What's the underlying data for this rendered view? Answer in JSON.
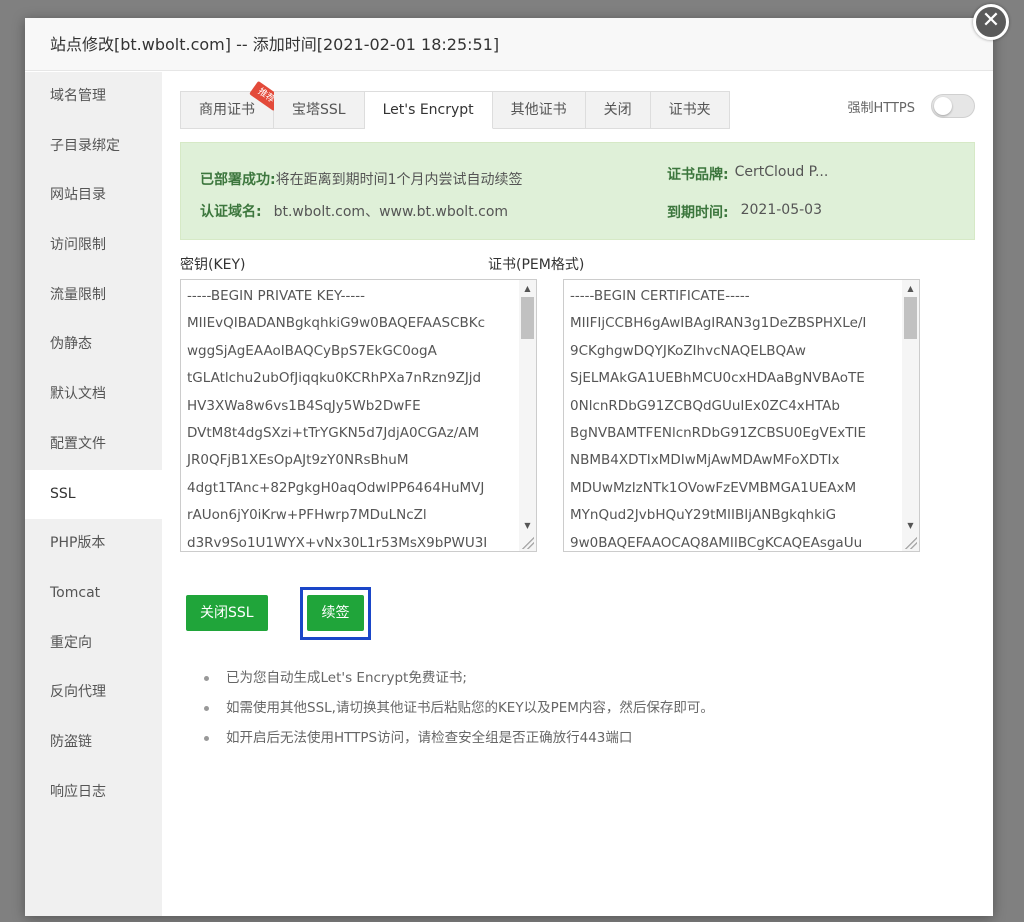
{
  "dialog": {
    "title": "站点修改[bt.wbolt.com] -- 添加时间[2021-02-01 18:25:51]",
    "close_icon": "close-icon"
  },
  "sidebar": {
    "items": [
      {
        "label": "域名管理"
      },
      {
        "label": "子目录绑定"
      },
      {
        "label": "网站目录"
      },
      {
        "label": "访问限制"
      },
      {
        "label": "流量限制"
      },
      {
        "label": "伪静态"
      },
      {
        "label": "默认文档"
      },
      {
        "label": "配置文件"
      },
      {
        "label": "SSL",
        "active": true
      },
      {
        "label": "PHP版本"
      },
      {
        "label": "Tomcat"
      },
      {
        "label": "重定向"
      },
      {
        "label": "反向代理"
      },
      {
        "label": "防盗链"
      },
      {
        "label": "响应日志"
      }
    ]
  },
  "tabs": [
    {
      "label": "商用证书",
      "badge": "推荐"
    },
    {
      "label": "宝塔SSL"
    },
    {
      "label": "Let's Encrypt",
      "active": true
    },
    {
      "label": "其他证书"
    },
    {
      "label": "关闭"
    },
    {
      "label": "证书夹"
    }
  ],
  "force_https": {
    "label": "强制HTTPS",
    "enabled": false
  },
  "info": {
    "deploy_label": "已部署成功:",
    "deploy_value": "将在距离到期时间1个月内尝试自动续签",
    "domain_label": "认证域名:",
    "domain_value": "bt.wbolt.com、www.bt.wbolt.com",
    "brand_label": "证书品牌:",
    "brand_value": "CertCloud P...",
    "expire_label": "到期时间:",
    "expire_value": "2021-05-03"
  },
  "key_field": {
    "label": "密钥(KEY)",
    "value": "-----BEGIN PRIVATE KEY-----\nMIIEvQIBADANBgkqhkiG9w0BAQEFAASCBKc\nwggSjAgEAAoIBAQCyBpS7EkGC0ogA\ntGLAtlchu2ubOfJiqqku0KCRhPXa7nRzn9ZJjd\nHV3XWa8w6vs1B4SqJy5Wb2DwFE\nDVtM8t4dgSXzi+tTrYGKN5d7JdjA0CGAz/AM\nJR0QFjB1XEsOpAJt9zY0NRsBhuM\n4dgt1TAnc+82PgkgH0aqOdwlPP6464HuMVJ\nrAUon6jY0iKrw+PFHwrp7MDuLNcZl\nd3Rv9So1U1WYX+vNx30L1r53MsX9bPWU3I"
  },
  "cert_field": {
    "label": "证书(PEM格式)",
    "value": "-----BEGIN CERTIFICATE-----\nMIIFIjCCBH6gAwIBAgIRAN3g1DeZBSPHXLe/I\n9CKghgwDQYJKoZIhvcNAQELBQAw\nSjELMAkGA1UEBhMCU0cxHDAaBgNVBAoTE\n0NlcnRDbG91ZCBQdGUuIEx0ZC4xHTAb\nBgNVBAMTFENlcnRDbG91ZCBSU0EgVExTIE\nNBMB4XDTIxMDIwMjAwMDAwMFoXDTIx\nMDUwMzIzNTk1OVowFzEVMBMGA1UEAxM\nMYnQud2JvbHQuY29tMIIBIjANBgkqhkiG\n9w0BAQEFAAOCAQ8AMIIBCgKCAQEAsgaUu"
  },
  "buttons": {
    "close_ssl": "关闭SSL",
    "renew": "续签"
  },
  "notes": [
    "已为您自动生成Let's Encrypt免费证书;",
    "如需使用其他SSL,请切换其他证书后粘贴您的KEY以及PEM内容，然后保存即可。",
    "如开启后无法使用HTTPS访问，请检查安全组是否正确放行443端口"
  ],
  "colors": {
    "primary_green": "#20a53a",
    "info_bg": "#dff0d8",
    "highlight_blue": "#1a46c8"
  }
}
